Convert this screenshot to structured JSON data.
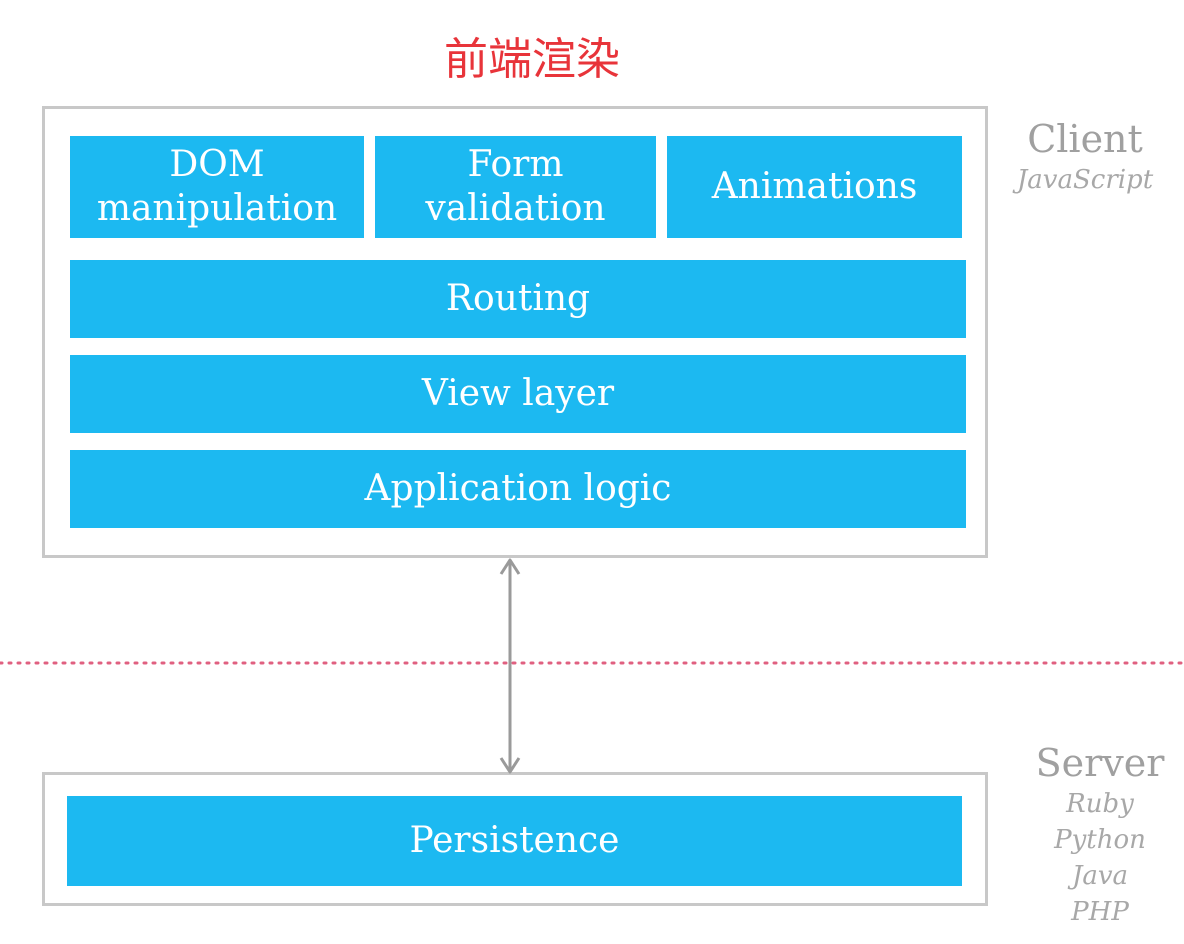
{
  "title": "前端渲染",
  "client": {
    "label": "Client",
    "language": "JavaScript",
    "blocks": {
      "dom": [
        "DOM",
        "manipulation"
      ],
      "form": [
        "Form",
        "validation"
      ],
      "animations": "Animations",
      "routing": "Routing",
      "view_layer": "View layer",
      "application_logic": "Application logic"
    }
  },
  "server": {
    "label": "Server",
    "languages": [
      "Ruby",
      "Python",
      "Java",
      "PHP"
    ],
    "blocks": {
      "persistence": "Persistence"
    }
  },
  "colors": {
    "block_fill": "#1cb9f1",
    "title": "#e8343a",
    "divider": "#e06080",
    "frame": "#c8c8c8",
    "arrow": "#9a9a9a"
  }
}
